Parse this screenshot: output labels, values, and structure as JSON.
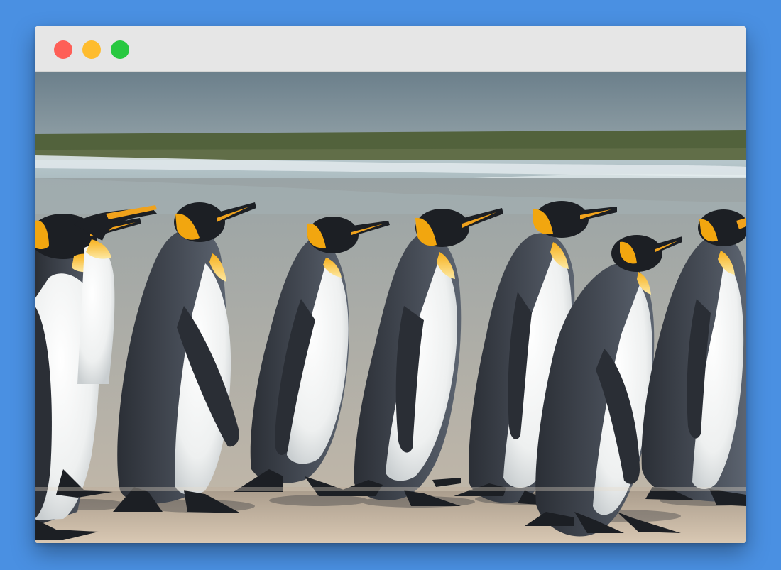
{
  "colors": {
    "desktop_background": "#4a90e2",
    "titlebar_background": "#e6e6e6",
    "close_button": "#fe5f57",
    "minimize_button": "#febc2e",
    "maximize_button": "#28c840"
  },
  "window": {
    "controls": [
      {
        "name": "close",
        "icon": "close-dot-icon"
      },
      {
        "name": "minimize",
        "icon": "minimize-dot-icon"
      },
      {
        "name": "maximize",
        "icon": "maximize-dot-icon"
      }
    ]
  },
  "content": {
    "image_subject": "penguin-photo"
  }
}
